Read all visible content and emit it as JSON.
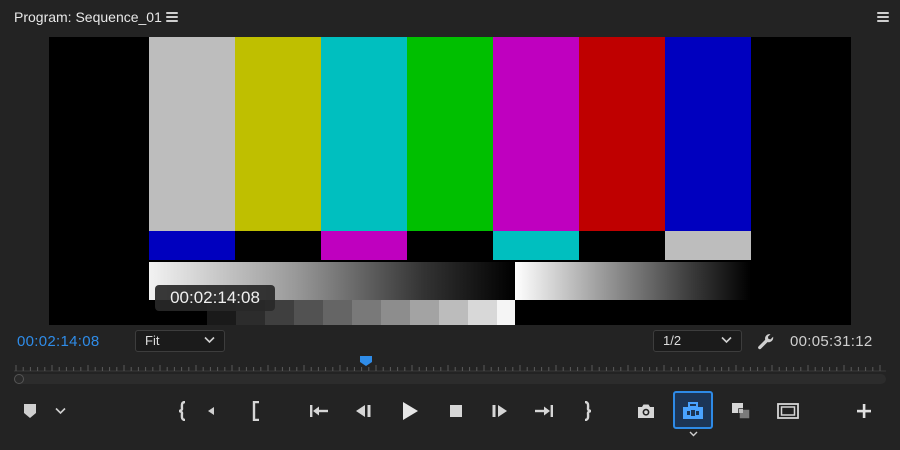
{
  "panel": {
    "title": "Program: Sequence_01"
  },
  "viewer": {
    "overlay_timecode": "00:02:14:08"
  },
  "status": {
    "current_timecode": "00:02:14:08",
    "duration_timecode": "00:05:31:12",
    "zoom": {
      "selected": "Fit"
    },
    "resolution": {
      "selected": "1/2"
    }
  },
  "icons": {
    "panel_menu": "hamburger-icon",
    "marker": "marker-icon",
    "mark_in": "mark-in-icon",
    "mark_out": "mark-out-icon",
    "go_to_in": "go-to-in-icon",
    "step_back": "step-back-icon",
    "play": "play-icon",
    "stop": "stop-icon",
    "step_forward": "step-forward-icon",
    "go_to_out": "go-to-out-icon",
    "export_frame": "camera-icon",
    "button_editor": "toolbox-icon",
    "comparison_view": "comparison-view-icon",
    "safe_margins": "safe-margins-icon",
    "add": "plus-icon",
    "settings": "wrench-icon"
  },
  "colors": {
    "accent": "#2f8ce8",
    "panel_bg": "#232323",
    "bars_top": [
      "#bdbdbd",
      "#bfbf00",
      "#00bfbf",
      "#00bf00",
      "#bf00bf",
      "#bf0000",
      "#0000bf"
    ],
    "bars_mid": [
      "#0000bf",
      "#000000",
      "#bf00bf",
      "#000000",
      "#00bfbf",
      "#000000",
      "#bdbdbd"
    ]
  }
}
